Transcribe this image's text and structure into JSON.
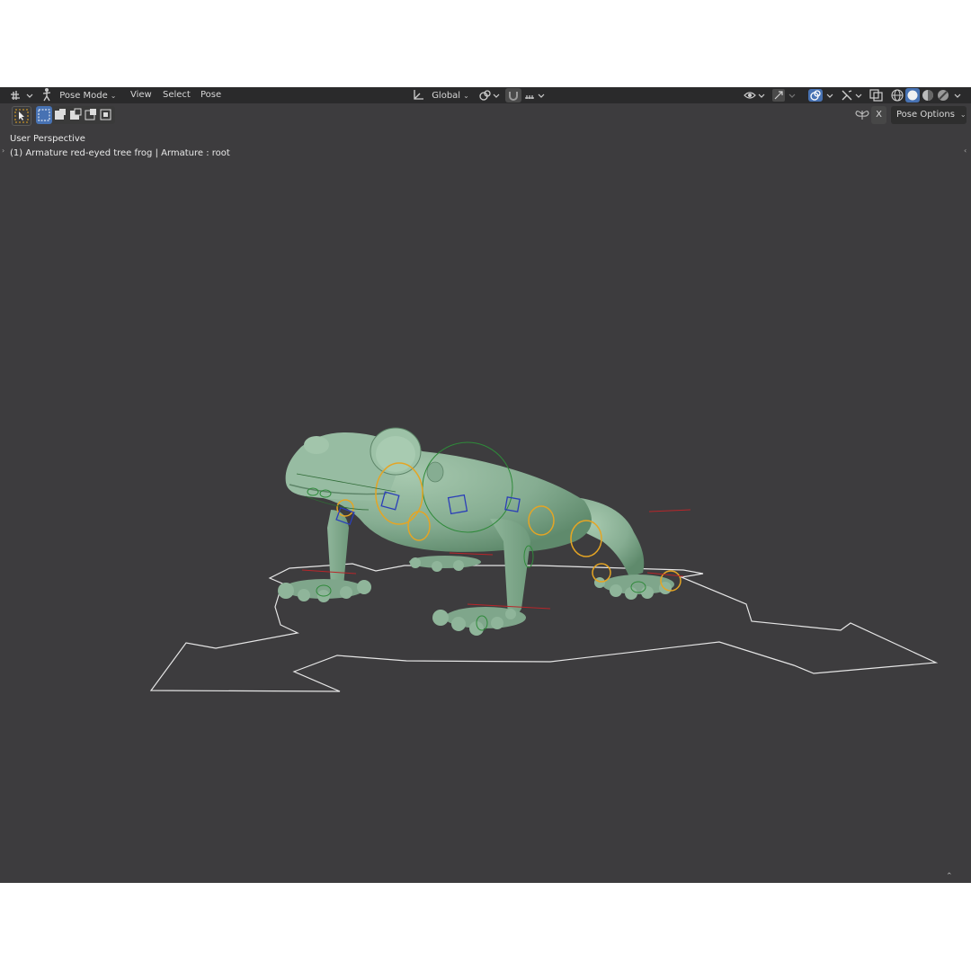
{
  "header": {
    "mode_label": "Pose Mode",
    "menus": [
      "View",
      "Select",
      "Pose"
    ],
    "orientation_label": "Global"
  },
  "toolbar": {
    "pose_options_label": "Pose Options",
    "x_mirror_label": "X"
  },
  "viewport": {
    "perspective_label": "User Perspective",
    "object_label": "(1) Armature red-eyed tree frog | Armature : root"
  },
  "colors": {
    "viewport_bg": "#3d3c3e",
    "header_bg": "#2a2a2b",
    "frog_body": "#8fb59a",
    "bone_selected": "#e5a524",
    "bone_green": "#2f8a3a",
    "bone_blue": "#2b3fb8",
    "bone_red": "#b8262a",
    "accent_blue": "#4772b3"
  }
}
